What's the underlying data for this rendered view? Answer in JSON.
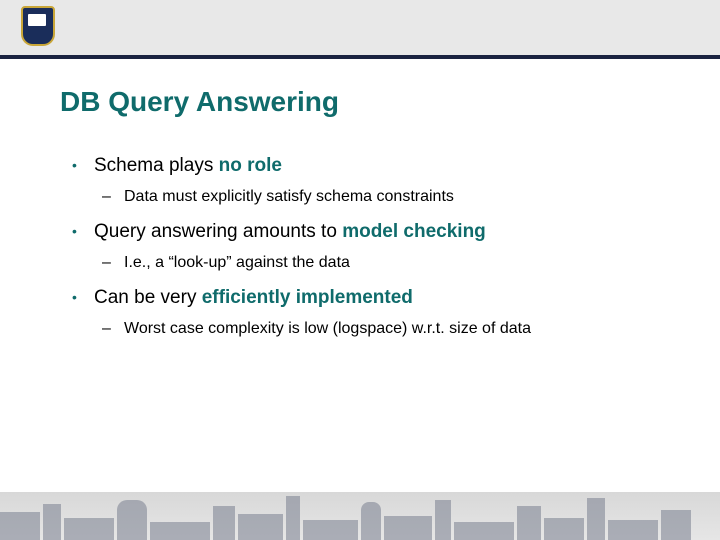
{
  "title": "DB Query Answering",
  "bullets": [
    {
      "pre": "Schema plays ",
      "strong": "no role",
      "post": "",
      "sub": "Data must explicitly satisfy schema constraints"
    },
    {
      "pre": "Query answering amounts to ",
      "strong": "model checking",
      "post": "",
      "sub": "I.e., a “look-up” against the data"
    },
    {
      "pre": "Can be very ",
      "strong": "efficiently implemented",
      "post": "",
      "sub": "Worst case complexity is low (logspace) w.r.t. size of data"
    }
  ],
  "colors": {
    "accent": "#0f6b6b",
    "header_line": "#1a2340"
  }
}
